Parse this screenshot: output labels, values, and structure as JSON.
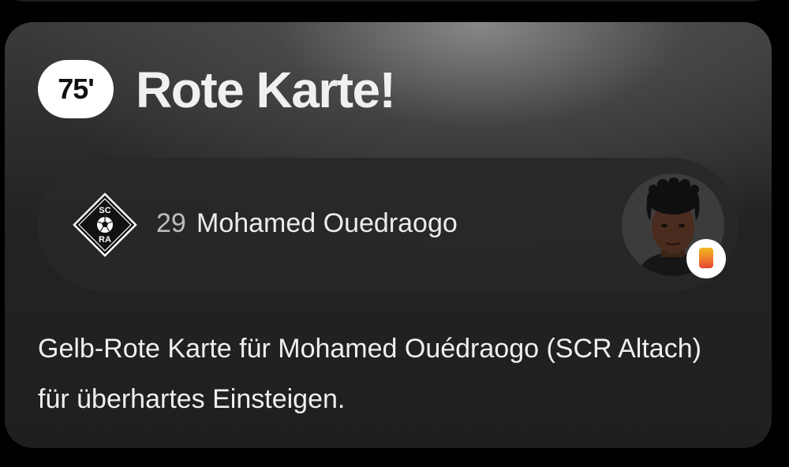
{
  "event": {
    "minute": "75'",
    "title": "Rote Karte!",
    "description": "Gelb-Rote Karte für Mohamed Ouédraogo (SCR Altach) für überhartes Einsteigen.",
    "card_type_icon": "yellow-red-card-icon"
  },
  "player": {
    "number": "29",
    "name": "Mohamed Ouedraogo",
    "club_logo": "scr-altach-logo",
    "club_logo_text_top": "SC",
    "club_logo_text_bottom": "RA"
  },
  "colors": {
    "background": "#000000",
    "card": "#232323",
    "badge": "#ffffff",
    "card_yellow": "#f2b51e",
    "card_red": "#e64533"
  }
}
